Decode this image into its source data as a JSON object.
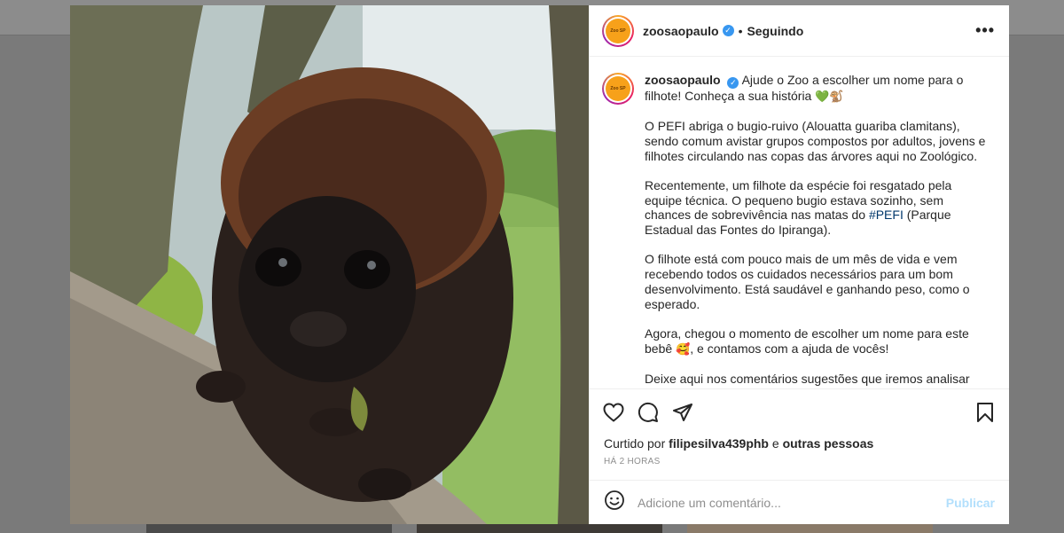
{
  "post": {
    "username": "zoosaopaulo",
    "verified_mark": "✓",
    "separator": "•",
    "follow_status": "Seguindo",
    "more_options": "•••",
    "avatar_logo_text": "Zoo SP",
    "caption": {
      "username": "zoosaopaulo",
      "line1": "Ajude o Zoo a escolher um nome para o filhote! Conheça a sua história",
      "line1_emojis": "💚🐒",
      "para1": "O PEFI abriga o bugio-ruivo (Alouatta guariba clamitans), sendo comum avistar grupos compostos por adultos, jovens e filhotes circulando nas copas das árvores aqui no Zoológico.",
      "para2_a": "Recentemente, um filhote da espécie foi resgatado pela equipe técnica. O pequeno bugio estava sozinho, sem chances de sobrevivência nas matas do",
      "para2_hashtag": "#PEFI",
      "para2_b": "(Parque Estadual das Fontes do Ipiranga).",
      "para3": "O filhote está com pouco mais de um mês de vida e vem recebendo todos os cuidados necessários para um bom desenvolvimento. Está saudável e ganhando peso, como o esperado.",
      "para4_a": "Agora, chegou o momento de escolher um nome para este bebê",
      "para4_emoji": "🥰",
      "para4_b": ", e contamos com a ajuda de vocês!",
      "para5": "Deixe aqui nos comentários sugestões que iremos analisar com"
    },
    "likes": {
      "prefix": "Curtido por",
      "user": "filipesilva439phb",
      "conj": "e",
      "others": "outras pessoas"
    },
    "timestamp": "HÁ 2 HORAS",
    "comment": {
      "placeholder": "Adicione um comentário...",
      "publish_label": "Publicar"
    }
  },
  "icons": {
    "like": "heart-icon",
    "comment": "comment-icon",
    "share": "share-icon",
    "save": "bookmark-icon",
    "emoji": "emoji-icon"
  },
  "colors": {
    "verified": "#3897f0",
    "hashtag": "#00376b",
    "publish_disabled": "#b2dffc",
    "avatar_logo": "#f7a11a"
  }
}
